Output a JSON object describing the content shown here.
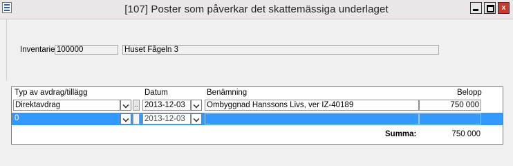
{
  "window": {
    "title": "[107]  Poster som påverkar det skattemässiga underlaget",
    "buttons": {
      "min": "",
      "max": "",
      "close": "x"
    }
  },
  "form": {
    "inventarie_label": "Inventarie",
    "inventarie_id": "100000",
    "inventarie_name": "Huset Fågeln 3"
  },
  "grid": {
    "headers": {
      "typ": "Typ av avdrag/tillägg",
      "datum": "Datum",
      "benamning": "Benämning",
      "belopp": "Belopp"
    },
    "rows": [
      {
        "typ": "Direktavdrag",
        "datum": "2013-12-03",
        "benamning": "Ombyggnad Hanssons Livs, ver IZ-40189",
        "belopp": "750 000",
        "ellipsis": ".."
      },
      {
        "typ": "0",
        "datum": "2013-12-03",
        "benamning": "",
        "belopp": ""
      }
    ],
    "summa_label": "Summa:",
    "summa_value": "750 000"
  }
}
